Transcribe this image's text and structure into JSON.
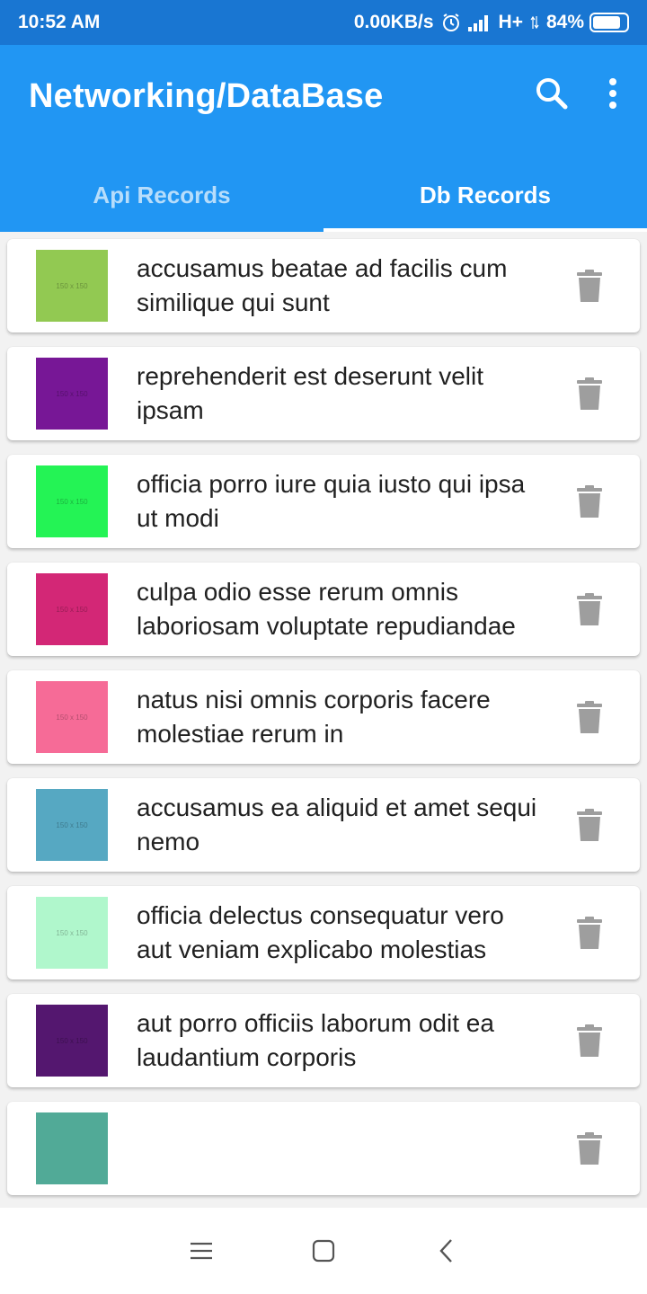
{
  "status_bar": {
    "time": "10:52 AM",
    "net_speed": "0.00KB/s",
    "network": "H+",
    "battery": "84%",
    "battery_level": 0.84
  },
  "app_bar": {
    "title": "Networking/DataBase",
    "background": "#2196f3",
    "icons": [
      "search-icon",
      "more-vertical-icon"
    ]
  },
  "tabs": [
    {
      "label": "Api Records",
      "active": false
    },
    {
      "label": "Db Records",
      "active": true
    }
  ],
  "records": [
    {
      "title": "accusamus beatae ad facilis cum similique qui sunt",
      "color": "#92c952",
      "thumb_label": "150 x 150"
    },
    {
      "title": "reprehenderit est deserunt velit ipsam",
      "color": "#771796",
      "thumb_label": "150 x 150"
    },
    {
      "title": "officia porro iure quia iusto qui ipsa ut modi",
      "color": "#24f355",
      "thumb_label": "150 x 150"
    },
    {
      "title": "culpa odio esse rerum omnis laboriosam voluptate repudiandae",
      "color": "#d32776",
      "thumb_label": "150 x 150"
    },
    {
      "title": "natus nisi omnis corporis facere molestiae rerum in",
      "color": "#f66b97",
      "thumb_label": "150 x 150"
    },
    {
      "title": "accusamus ea aliquid et amet sequi nemo",
      "color": "#56a8c2",
      "thumb_label": "150 x 150"
    },
    {
      "title": "officia delectus consequatur vero aut veniam explicabo molestias",
      "color": "#b0f7cc",
      "thumb_label": "150 x 150"
    },
    {
      "title": "aut porro officiis laborum odit ea laudantium corporis",
      "color": "#54176f",
      "thumb_label": "150 x 150"
    },
    {
      "title": "",
      "color": "#51aa97",
      "thumb_label": ""
    }
  ],
  "nav_bar": {
    "icons": [
      "menu-icon",
      "home-square-icon",
      "back-chevron-icon"
    ]
  }
}
